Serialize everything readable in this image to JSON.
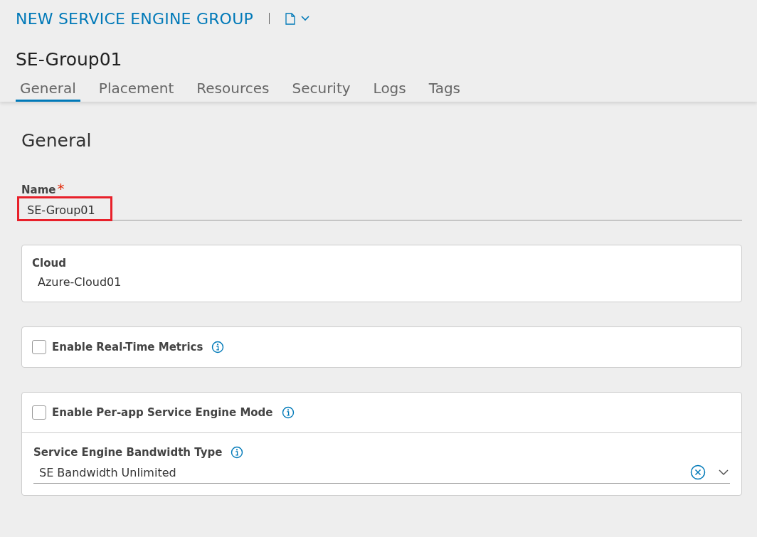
{
  "header": {
    "title": "NEW SERVICE ENGINE GROUP",
    "subtitle": "SE-Group01"
  },
  "tabs": [
    {
      "label": "General",
      "selected": true
    },
    {
      "label": "Placement",
      "selected": false
    },
    {
      "label": "Resources",
      "selected": false
    },
    {
      "label": "Security",
      "selected": false
    },
    {
      "label": "Logs",
      "selected": false
    },
    {
      "label": "Tags",
      "selected": false
    }
  ],
  "section_title": "General",
  "name_field": {
    "label": "Name",
    "required_mark": "*",
    "value": "SE-Group01",
    "highlighted": true
  },
  "cloud": {
    "label": "Cloud",
    "value": "Azure-Cloud01"
  },
  "metrics": {
    "label": "Enable Real-Time Metrics",
    "checked": false
  },
  "per_app": {
    "label": "Enable Per-app Service Engine Mode",
    "checked": false
  },
  "bandwidth": {
    "label": "Service Engine Bandwidth Type",
    "value": "SE Bandwidth Unlimited"
  }
}
